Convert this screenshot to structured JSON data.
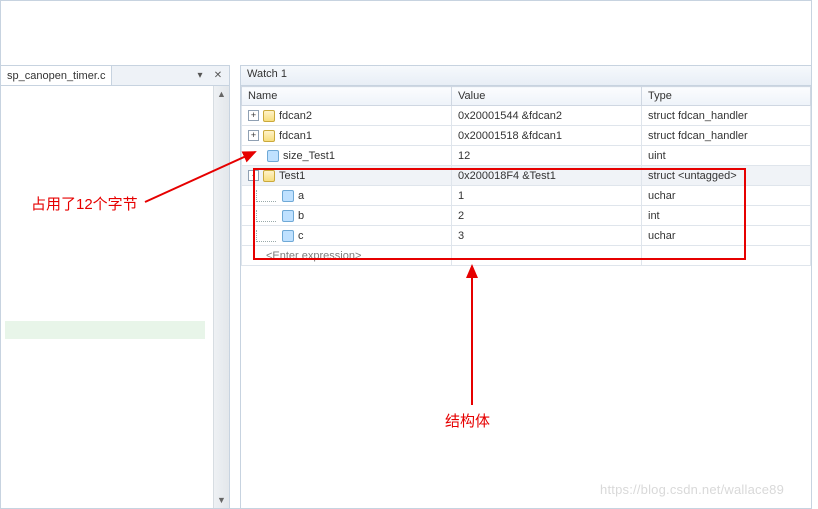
{
  "left_panel": {
    "tab_label": "sp_canopen_timer.c"
  },
  "right_panel": {
    "title": "Watch 1",
    "columns": {
      "name": "Name",
      "value": "Value",
      "type": "Type"
    },
    "rows": [
      {
        "expander": "+",
        "icon": "struct",
        "indent": 0,
        "name": "fdcan2",
        "value": "0x20001544 &fdcan2",
        "type": "struct fdcan_handler",
        "selected": false
      },
      {
        "expander": "+",
        "icon": "struct",
        "indent": 0,
        "name": "fdcan1",
        "value": "0x20001518 &fdcan1",
        "type": "struct fdcan_handler",
        "selected": false
      },
      {
        "expander": "",
        "icon": "var",
        "indent": 0,
        "name": "size_Test1",
        "value": "12",
        "type": "uint",
        "selected": false
      },
      {
        "expander": "-",
        "icon": "struct",
        "indent": 0,
        "name": "Test1",
        "value": "0x200018F4 &Test1",
        "type": "struct <untagged>",
        "selected": true
      },
      {
        "expander": "",
        "icon": "var",
        "indent": 1,
        "name": "a",
        "value": "1",
        "type": "uchar",
        "selected": false
      },
      {
        "expander": "",
        "icon": "var",
        "indent": 1,
        "name": "b",
        "value": "2",
        "type": "int",
        "selected": false
      },
      {
        "expander": "",
        "icon": "var",
        "indent": 1,
        "name": "c",
        "value": "3",
        "type": "uchar",
        "selected": false
      }
    ],
    "placeholder": "<Enter expression>"
  },
  "annotations": {
    "left": "占用了12个字节",
    "bottom": "结构体"
  },
  "watermark": "https://blog.csdn.net/wallace89"
}
